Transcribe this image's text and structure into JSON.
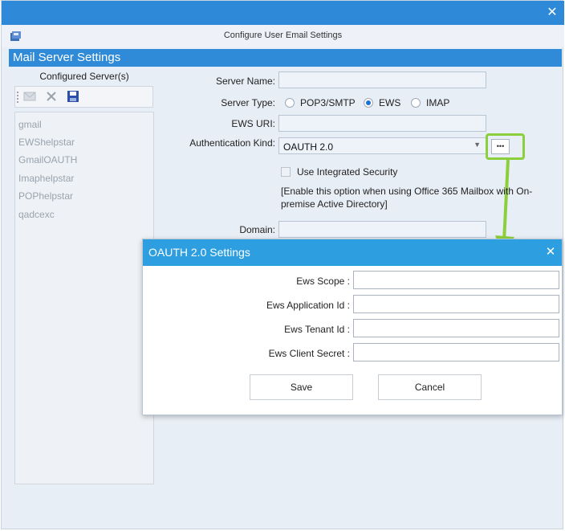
{
  "window": {
    "title": "Configure User Email Settings",
    "close_glyph": "✕",
    "accent_color": "#2e8ad8"
  },
  "section": {
    "header": "Mail Server Settings"
  },
  "servers": {
    "title": "Configured Server(s)",
    "toolbar_icons": [
      "new-mail-icon",
      "delete-icon",
      "save-icon"
    ],
    "items": [
      "gmail",
      "EWShelpstar",
      "GmailOAUTH",
      "Imaphelpstar",
      "POPhelpstar",
      "qadcexc"
    ]
  },
  "form": {
    "server_name_label": "Server Name:",
    "server_name_value": "",
    "server_type_label": "Server Type:",
    "server_types": [
      "POP3/SMTP",
      "EWS",
      "IMAP"
    ],
    "server_type_selected": "EWS",
    "ews_uri_label": "EWS URI:",
    "ews_uri_value": "",
    "auth_kind_label": "Authentication Kind:",
    "auth_kind_value": "OAUTH 2.0",
    "more_button": "•••",
    "integrated_security_label": "Use Integrated Security",
    "integrated_security_note": "[Enable this option when using Office 365 Mailbox with On-premise Active Directory]",
    "domain_label": "Domain:",
    "domain_value": ""
  },
  "dialog": {
    "title": "OAUTH 2.0 Settings",
    "close_glyph": "✕",
    "fields": [
      {
        "label": "Ews Scope :",
        "value": ""
      },
      {
        "label": "Ews Application Id :",
        "value": ""
      },
      {
        "label": "Ews Tenant Id :",
        "value": ""
      },
      {
        "label": "Ews Client Secret :",
        "value": ""
      }
    ],
    "save_label": "Save",
    "cancel_label": "Cancel"
  },
  "annotation": {
    "highlight_color": "#8ccf3c"
  }
}
